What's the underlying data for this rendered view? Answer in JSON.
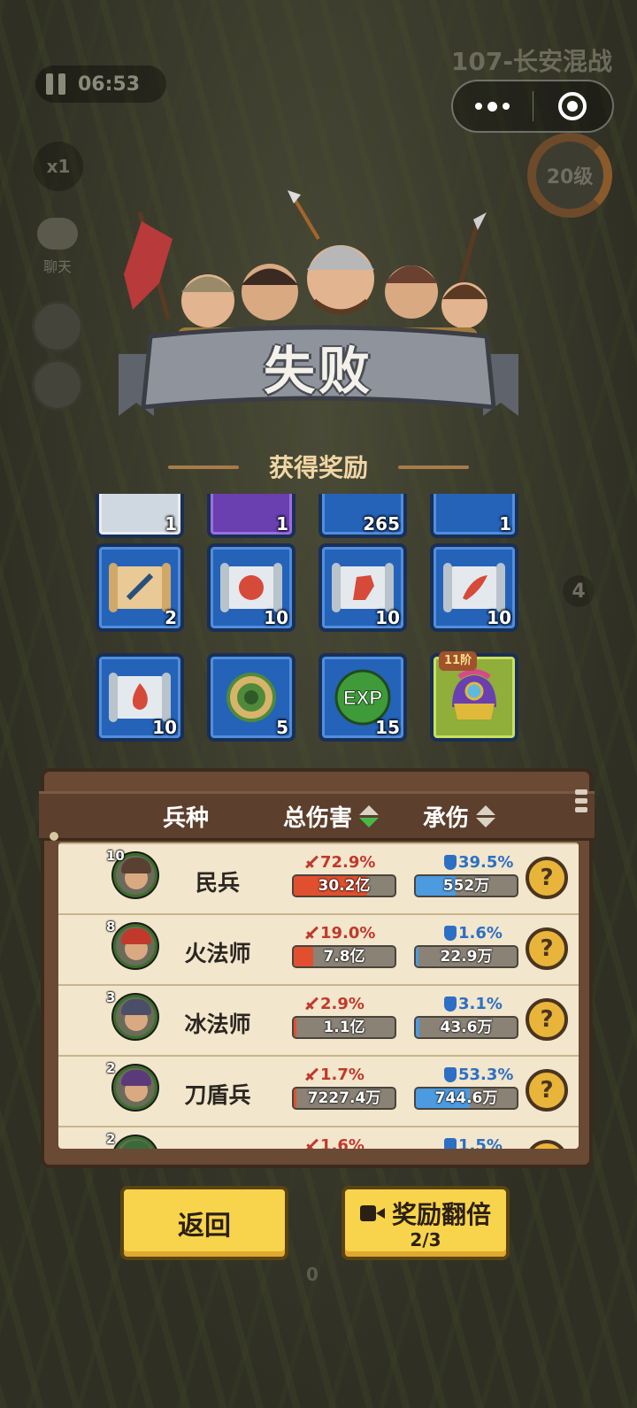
{
  "hud": {
    "timer": "06:53",
    "stage_name": "107-长安混战",
    "speed": "x1",
    "chat_label": "聊天",
    "level": "20级",
    "side_count": "4",
    "bottom_count": "0"
  },
  "result": {
    "title": "失败",
    "rewards_heading": "获得奖励"
  },
  "rewards": {
    "row0": [
      {
        "icon": "item-icon",
        "count": "1"
      },
      {
        "icon": "item-icon",
        "count": "1"
      },
      {
        "icon": "item-icon",
        "count": "265"
      },
      {
        "icon": "item-icon",
        "count": "1"
      }
    ],
    "row1": [
      {
        "icon": "sword-scroll-icon",
        "count": "2"
      },
      {
        "icon": "axe-scroll-icon",
        "count": "10"
      },
      {
        "icon": "horse-scroll-icon",
        "count": "10"
      },
      {
        "icon": "blade-scroll-icon",
        "count": "10"
      }
    ],
    "row2": [
      {
        "icon": "fire-scroll-icon",
        "count": "10"
      },
      {
        "icon": "jade-ring-icon",
        "count": "5"
      },
      {
        "icon": "exp-orb-icon",
        "count": "15",
        "label": "EXP"
      },
      {
        "icon": "helmet-icon",
        "badge": "11阶"
      }
    ]
  },
  "table": {
    "col_type": "兵种",
    "col_damage": "总伤害",
    "col_taken": "承伤",
    "rows": [
      {
        "level": "10",
        "name": "民兵",
        "dmg_pct": "72.9%",
        "dmg_val": "30.2亿",
        "dmg_fill": 0.729,
        "taken_pct": "39.5%",
        "taken_val": "552万",
        "taken_fill": 0.395,
        "helm_color": "#5a4030"
      },
      {
        "level": "8",
        "name": "火法师",
        "dmg_pct": "19.0%",
        "dmg_val": "7.8亿",
        "dmg_fill": 0.19,
        "taken_pct": "1.6%",
        "taken_val": "22.9万",
        "taken_fill": 0.016,
        "helm_color": "#c0392b"
      },
      {
        "level": "3",
        "name": "冰法师",
        "dmg_pct": "2.9%",
        "dmg_val": "1.1亿",
        "dmg_fill": 0.029,
        "taken_pct": "3.1%",
        "taken_val": "43.6万",
        "taken_fill": 0.031,
        "helm_color": "#4a4e68"
      },
      {
        "level": "2",
        "name": "刀盾兵",
        "dmg_pct": "1.7%",
        "dmg_val": "7227.4万",
        "dmg_fill": 0.017,
        "taken_pct": "53.3%",
        "taken_val": "744.6万",
        "taken_fill": 0.533,
        "helm_color": "#5b3a7a"
      },
      {
        "level": "2",
        "name": "",
        "dmg_pct": "1.6%",
        "dmg_val": "",
        "dmg_fill": 0.016,
        "taken_pct": "1.5%",
        "taken_val": "",
        "taken_fill": 0.015,
        "helm_color": "#3a6a3a"
      }
    ]
  },
  "buttons": {
    "back": "返回",
    "double": "奖励翻倍",
    "double_count": "2/3"
  },
  "colors": {
    "button_yellow": "#f8d44c",
    "damage_red": "#e0502f",
    "taken_blue": "#4c9ae0",
    "reward_blue": "#2563b8"
  }
}
